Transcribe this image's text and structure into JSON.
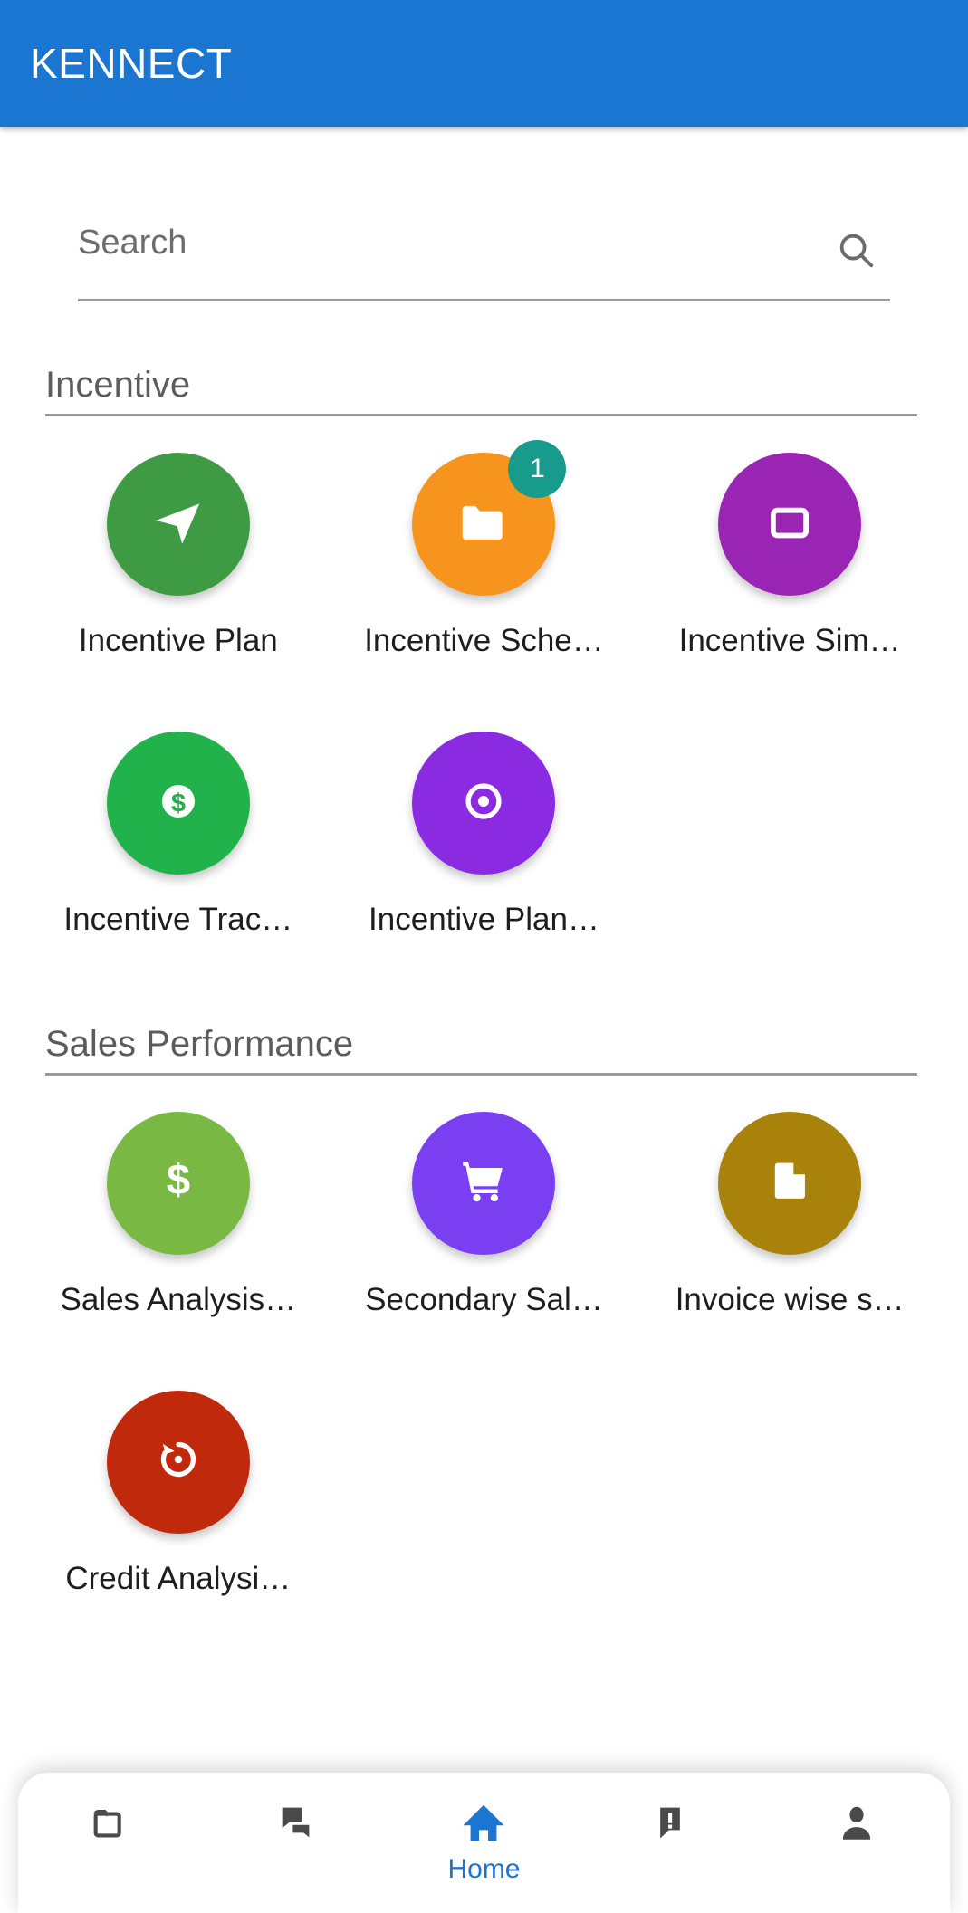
{
  "appbar": {
    "title": "KENNECT",
    "background": "#1b76d1",
    "text_color": "#ffffff"
  },
  "search": {
    "placeholder": "Search",
    "value": "",
    "icon": "search-icon"
  },
  "sections": [
    {
      "title": "Incentive",
      "items": [
        {
          "label": "Incentive Plan",
          "icon": "send-icon",
          "color": "#3f9a44",
          "badge": null
        },
        {
          "label": "Incentive Sche…",
          "icon": "folder-icon",
          "color": "#f7941d",
          "badge": "1",
          "badge_color": "#169b8c"
        },
        {
          "label": "Incentive Sim…",
          "icon": "window-icon",
          "color": "#9a25b5",
          "badge": null
        },
        {
          "label": "Incentive Trac…",
          "icon": "dollar-circle-icon",
          "color": "#21b24b",
          "badge": null
        },
        {
          "label": "Incentive Plan…",
          "icon": "target-dot-icon",
          "color": "#8a2be2",
          "badge": null
        }
      ]
    },
    {
      "title": "Sales Performance",
      "items": [
        {
          "label": "Sales Analysis…",
          "icon": "dollar-sign-icon",
          "color": "#78b843",
          "badge": null
        },
        {
          "label": "Secondary Sal…",
          "icon": "shopping-cart-icon",
          "color": "#7b3ff2",
          "badge": null
        },
        {
          "label": "Invoice wise s…",
          "icon": "document-icon",
          "color": "#a8820b",
          "badge": null
        },
        {
          "label": "Credit Analysi…",
          "icon": "history-icon",
          "color": "#c1290d",
          "badge": null
        }
      ]
    }
  ],
  "bottom_nav": {
    "active_color": "#1b76d1",
    "inactive_color": "#4a4a4a",
    "items": [
      {
        "label": "",
        "icon": "folder-outline-icon",
        "active": false
      },
      {
        "label": "",
        "icon": "chat-bubbles-icon",
        "active": false
      },
      {
        "label": "Home",
        "icon": "home-icon",
        "active": true
      },
      {
        "label": "",
        "icon": "alert-bubble-icon",
        "active": false
      },
      {
        "label": "",
        "icon": "person-icon",
        "active": false
      }
    ]
  }
}
